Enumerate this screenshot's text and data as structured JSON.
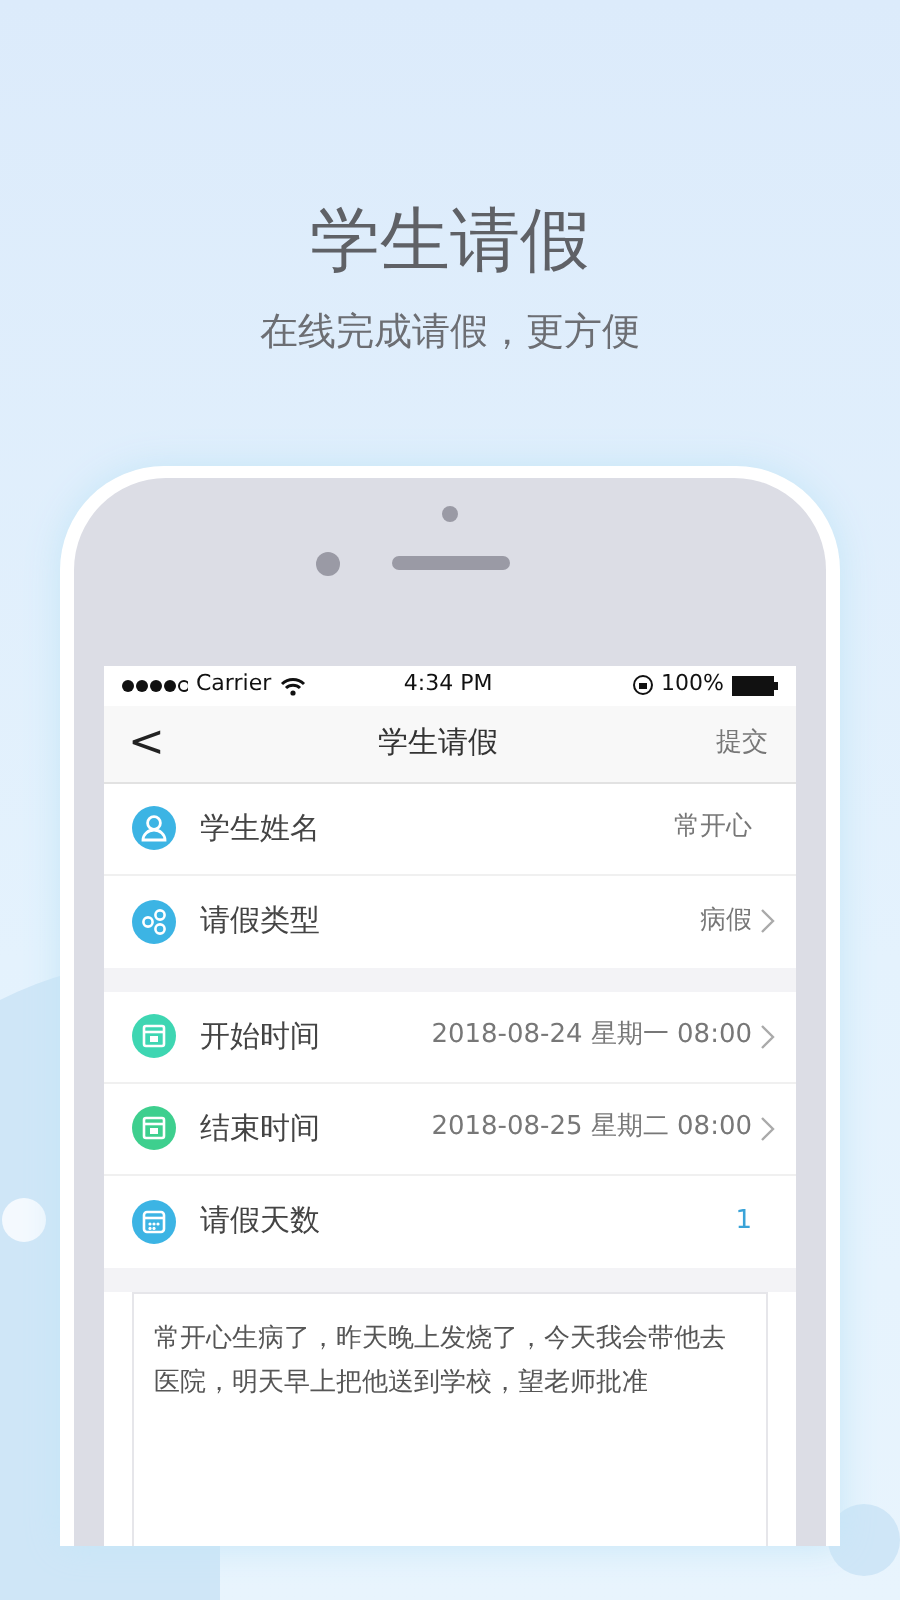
{
  "promo": {
    "title": "学生请假",
    "subtitle": "在线完成请假，更方便"
  },
  "status_bar": {
    "carrier": "Carrier",
    "time": "4:34 PM",
    "battery": "100%"
  },
  "nav": {
    "back": "<",
    "title": "学生请假",
    "action": "提交"
  },
  "groups": [
    [
      {
        "kind": "text",
        "label": "学生姓名",
        "value": "常开心",
        "color": "#3cb4e4"
      },
      {
        "kind": "select",
        "label": "请假类型",
        "value": "病假",
        "color": "#3cb4e4"
      }
    ],
    [
      {
        "kind": "date",
        "label": "开始时间",
        "value": "2018-08-24 星期一 08:00",
        "color": "#3ed6b2"
      },
      {
        "kind": "date",
        "label": "结束时间",
        "value": "2018-08-25 星期二 08:00",
        "color": "#3ecf8e"
      },
      {
        "kind": "count",
        "label": "请假天数",
        "value": "1",
        "color": "#3cb4e4"
      }
    ]
  ],
  "reason": {
    "value": "常开心生病了，昨天晚上发烧了，今天我会带他去医院，明天早上把他送到学校，望老师批准"
  }
}
